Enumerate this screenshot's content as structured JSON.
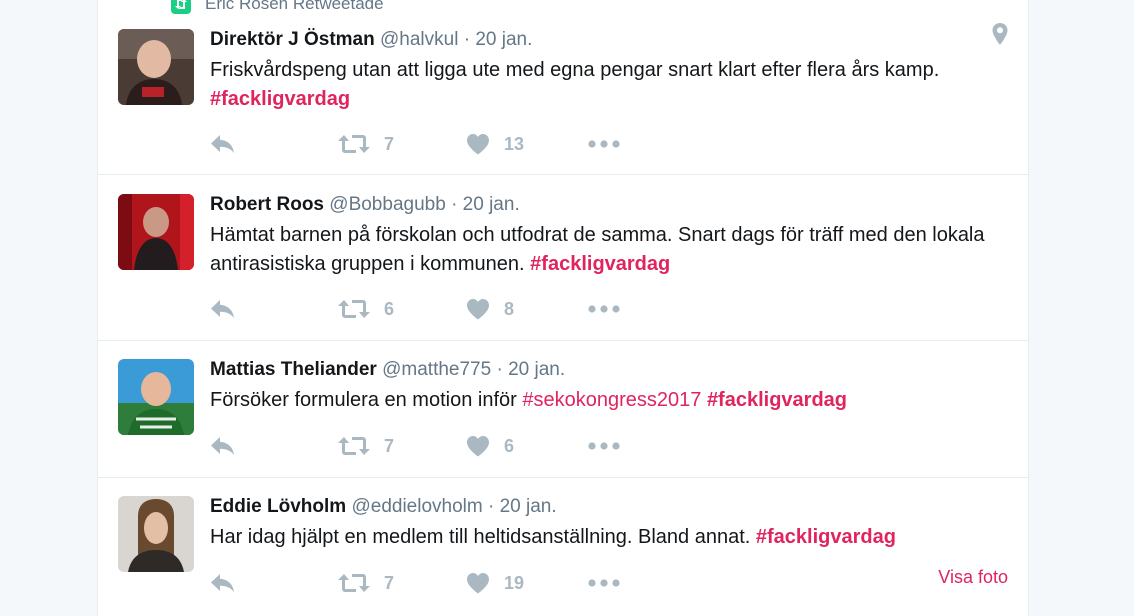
{
  "retweet_context": {
    "text": "Eric Rosén Retweetade"
  },
  "tweets": [
    {
      "name": "Direktör J Östman",
      "handle": "@halvkul",
      "sep": "·",
      "date": "20 jan.",
      "text": "Friskvårdspeng utan att ligga ute med egna pengar snart klart efter flera års kamp.",
      "tags": [
        "#fackligvardag"
      ],
      "retweets": "7",
      "likes": "13"
    },
    {
      "name": "Robert Roos",
      "handle": "@Bobbagubb",
      "sep": "·",
      "date": "20 jan.",
      "text": "Hämtat barnen på förskolan och utfodrat de samma. Snart dags för träff med den lokala antirasistiska gruppen i kommunen.",
      "tags": [
        "#fackligvardag"
      ],
      "retweets": "6",
      "likes": "8"
    },
    {
      "name": "Mattias Theliander",
      "handle": "@matthe775",
      "sep": "·",
      "date": "20 jan.",
      "text": "Försöker formulera en motion inför",
      "tags": [
        "#sekokongress2017",
        "#fackligvardag"
      ],
      "retweets": "7",
      "likes": "6"
    },
    {
      "name": "Eddie Lövholm",
      "handle": "@eddielovholm",
      "sep": "·",
      "date": "20 jan.",
      "text": "Har idag hjälpt en medlem till heltidsanställning. Bland annat.",
      "tags": [
        "#fackligvardag"
      ],
      "retweets": "7",
      "likes": "19",
      "media_link": "Visa foto"
    }
  ],
  "colors": {
    "hashtag": "#e0245e",
    "muted": "#657786",
    "action_icon": "#aab8c2",
    "retweet_badge": "#19cf86"
  },
  "icons": [
    "retweet-badge-icon",
    "location-pin-icon",
    "reply-icon",
    "retweet-icon",
    "heart-icon",
    "more-icon"
  ]
}
